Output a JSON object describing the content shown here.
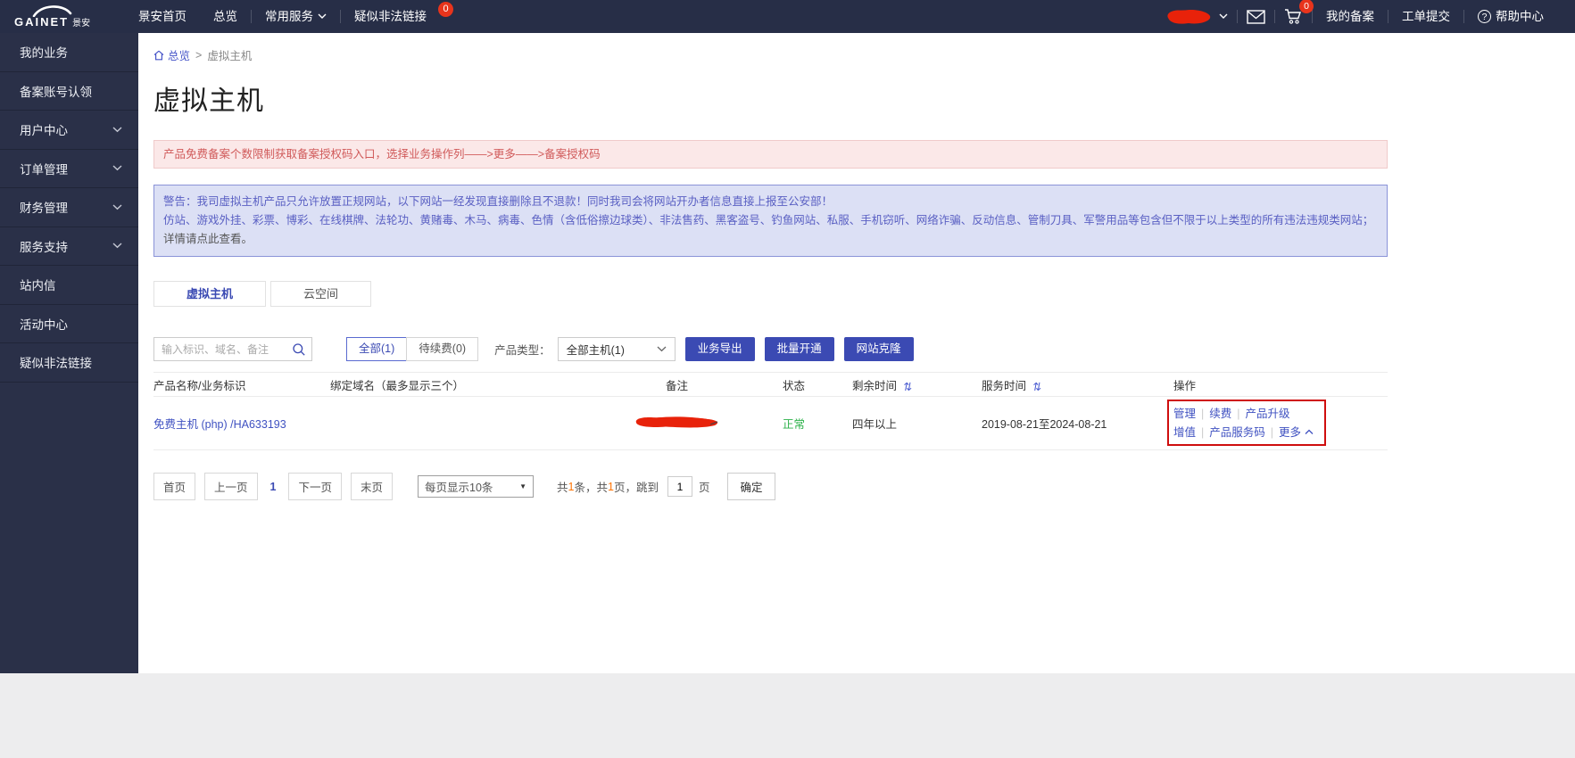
{
  "icons": {
    "help_glyph": "?",
    "sort_glyph": "⇅",
    "dropdown_triangle": "▼"
  },
  "colors": {
    "nav_bg": "#272e47",
    "accent": "#3b4ab3",
    "link": "#3f51c1",
    "status_green": "#2db14a",
    "badge_red": "#e8341c",
    "annotation_red": "#cf0e0e",
    "redaction_red": "#e8220a"
  },
  "topnav": {
    "logo": {
      "brand": "GAINET",
      "brand_cn": "景安"
    },
    "items": [
      {
        "label": "景安首页"
      },
      {
        "label": "总览"
      },
      {
        "label": "常用服务"
      },
      {
        "label": "疑似非法链接",
        "badge": "0"
      }
    ],
    "cart_badge": "0",
    "right_items": [
      {
        "label": "我的备案"
      },
      {
        "label": "工单提交"
      },
      {
        "label": "帮助中心"
      }
    ]
  },
  "sidebar": {
    "items": [
      {
        "label": "我的业务"
      },
      {
        "label": "备案账号认领"
      },
      {
        "label": "用户中心"
      },
      {
        "label": "订单管理"
      },
      {
        "label": "财务管理"
      },
      {
        "label": "服务支持"
      },
      {
        "label": "站内信"
      },
      {
        "label": "活动中心"
      },
      {
        "label": "疑似非法链接"
      }
    ]
  },
  "breadcrumb": {
    "home": "总览",
    "separator": ">",
    "current": "虚拟主机"
  },
  "page": {
    "title": "虚拟主机"
  },
  "notices": {
    "beian": "产品免费备案个数限制获取备案授权码入口，选择业务操作列——>更多——>备案授权码",
    "warning_line1": "警告：我司虚拟主机产品只允许放置正规网站，以下网站一经发现直接删除且不退款！同时我司会将网站开办者信息直接上报至公安部！",
    "warning_line2": "仿站、游戏外挂、彩票、博彩、在线棋牌、法轮功、黄赌毒、木马、病毒、色情（含低俗擦边球类）、非法售药、黑客盗号、钓鱼网站、私服、手机窃听、网络诈骗、反动信息、管制刀具、军警用品等包含但不限于以上类型的所有违法违规类网站；",
    "warning_link": "详情请点此查看。"
  },
  "tabs": [
    {
      "label": "虚拟主机"
    },
    {
      "label": "云空间"
    }
  ],
  "filters": {
    "search_placeholder": "输入标识、域名、备注",
    "all_label": "全部(1)",
    "renew_label": "待续费(0)",
    "type_label": "产品类型：",
    "type_value": "全部主机(1)",
    "export_label": "业务导出",
    "batch_label": "批量开通",
    "clone_label": "网站克隆"
  },
  "table": {
    "headers": [
      "产品名称/业务标识",
      "绑定域名（最多显示三个）",
      "备注",
      "状态",
      "剩余时间",
      "服务时间",
      "操作"
    ],
    "action_separator": "|",
    "rows": [
      {
        "name": "免费主机 (php) /HA633193",
        "domain": "",
        "status": "正常",
        "remaining": "四年以上",
        "service_time": "2019-08-21至2024-08-21",
        "actions_line1": [
          "管理",
          "续费",
          "产品升级"
        ],
        "actions_line2": [
          "增值",
          "产品服务码",
          "更多"
        ]
      }
    ]
  },
  "pagination": {
    "first": "首页",
    "prev": "上一页",
    "current": "1",
    "next": "下一页",
    "last": "末页",
    "per_page": "每页显示10条",
    "summary_pre": "共",
    "total_items": "1",
    "summary_mid": "条，共",
    "total_pages": "1",
    "summary_post": "页，跳到",
    "jump_value": "1",
    "page_unit": "页",
    "confirm": "确定"
  }
}
